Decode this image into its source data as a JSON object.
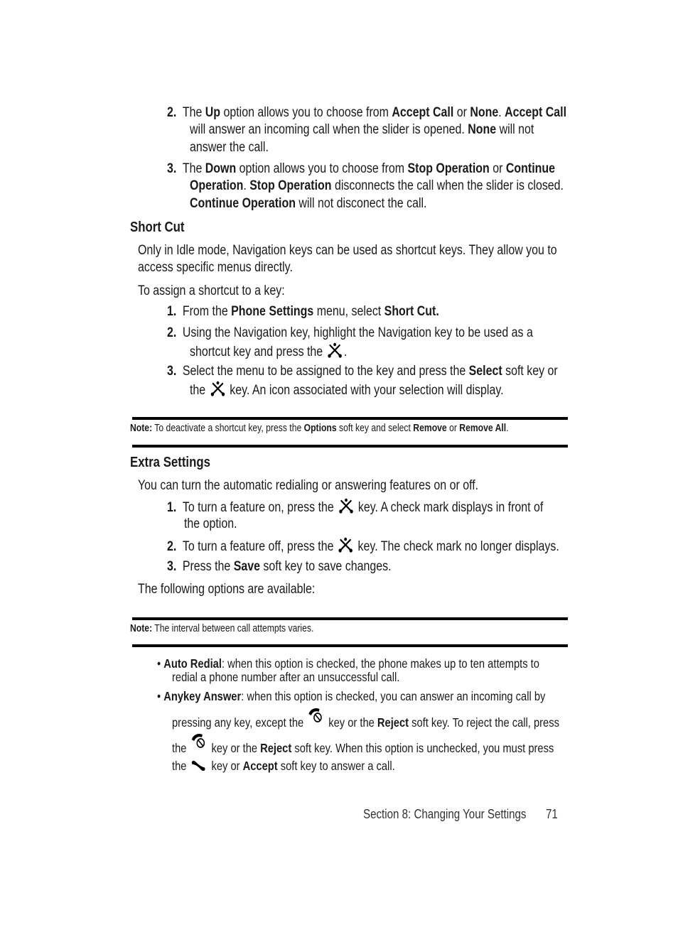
{
  "up_down_list": [
    {
      "num": "2.",
      "parts": [
        "The ",
        "Up",
        " option allows you to choose from ",
        "Accept Call",
        " or ",
        "None",
        ". ",
        "Accept Call"
      ],
      "line2": [
        "will answer an incoming call when the slider is opened. ",
        "None",
        " will not"
      ],
      "line3": "answer the call."
    },
    {
      "num": "3.",
      "parts": [
        "The ",
        "Down",
        " option allows you to choose from ",
        "Stop Operation",
        " or ",
        "Continue"
      ],
      "line2": [
        "Operation",
        ". ",
        "Stop Operation",
        " disconnects the call when the slider is closed."
      ],
      "line3": [
        "Continue Operation",
        " will not disconect the call."
      ]
    }
  ],
  "short_cut": {
    "heading": "Short Cut",
    "intro_line1": "Only in Idle mode, Navigation keys can be used as shortcut keys. They allow you to",
    "intro_line2": "access specific menus directly.",
    "assign_label": "To assign a shortcut to a key:",
    "steps": [
      {
        "num": "1.",
        "parts": [
          "From the ",
          "Phone Settings",
          " menu, select ",
          "Short Cut."
        ]
      },
      {
        "num": "2.",
        "line1": "Using the Navigation key, highlight the Navigation key to be used as a",
        "line2_before": "shortcut key and press the ",
        "line2_after": "."
      },
      {
        "num": "3.",
        "line1_parts": [
          "Select the menu to be assigned to the key and press the ",
          "Select",
          " soft key or"
        ],
        "line2_before": "the ",
        "line2_after": " key. An icon associated with your selection will display."
      }
    ],
    "note": {
      "label": "Note:",
      "parts": [
        " To deactivate a shortcut key, press the ",
        "Options",
        " soft key and select ",
        "Remove",
        " or ",
        "Remove All",
        "."
      ]
    }
  },
  "extra_settings": {
    "heading": "Extra Settings",
    "intro": "You can turn the automatic redialing or answering features on or off.",
    "steps": [
      {
        "num": "1.",
        "before": "To turn a feature on, press the ",
        "after": " key. A check mark displays in front of",
        "line2": "the option."
      },
      {
        "num": "2.",
        "before": "To turn a feature off, press the ",
        "after": " key. The check mark no longer displays."
      },
      {
        "num": "3.",
        "parts": [
          "Press the ",
          "Save",
          " soft key to save changes."
        ]
      }
    ],
    "options_label": "The following options are available:",
    "note": {
      "label": "Note:",
      "text": " The interval between call attempts varies."
    },
    "options": [
      {
        "name": "Auto Redial",
        "line1": ": when this option is checked, the phone makes up to ten attempts to",
        "line2": "redial a phone number after an unsuccessful call."
      },
      {
        "name": "Anykey Answer",
        "line1": ": when this option is checked, you can answer an incoming call by",
        "line2_before": "pressing any key, except the ",
        "line2_mid": " key or the ",
        "line2_bold": "Reject",
        "line2_after": " soft key. To reject the call, press",
        "line3_before": "the ",
        "line3_mid": " key or the ",
        "line3_bold": "Reject",
        "line3_after": " soft key. When this option is unchecked, you must press",
        "line4_before": "the ",
        "line4_mid": " key or ",
        "line4_bold": "Accept",
        "line4_after": " soft key to answer a call."
      }
    ]
  },
  "icons": {
    "nav_key": "nav-key-icon",
    "end_key": "end-key-icon",
    "send_key": "send-key-icon"
  },
  "footer": {
    "section": "Section 8: Changing Your Settings",
    "page_number": "71"
  }
}
